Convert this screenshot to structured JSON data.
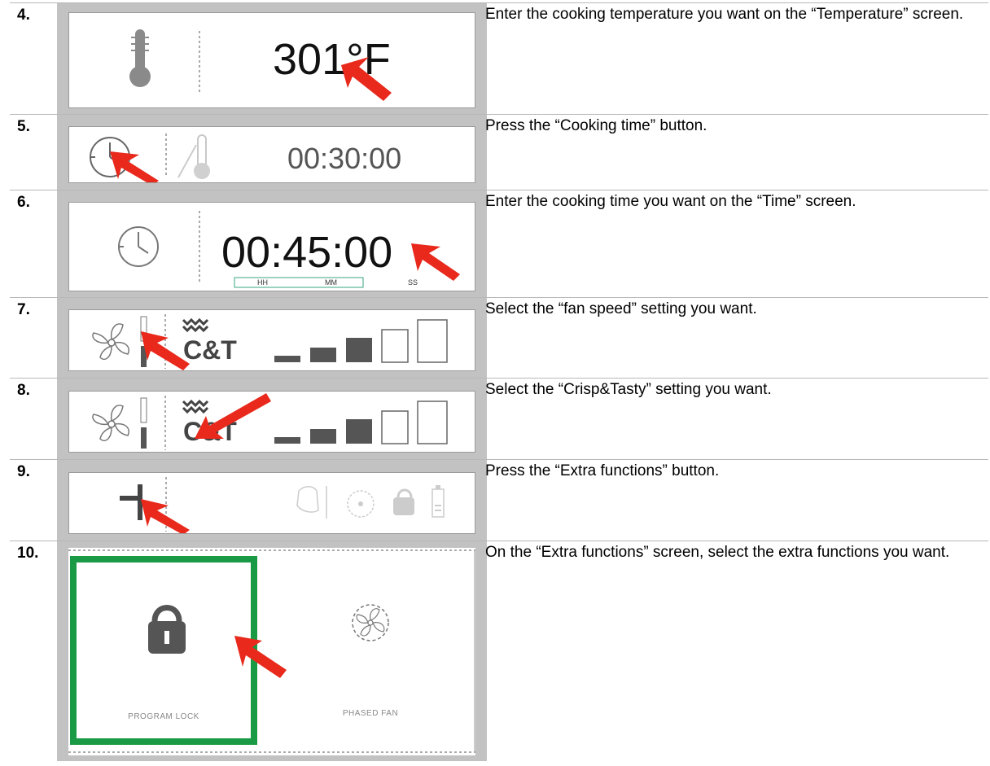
{
  "steps": [
    {
      "number": "4.",
      "text": "Enter the cooking temperature you want on the “Temperature” screen.",
      "display": "301°F",
      "icon": "thermometer-icon"
    },
    {
      "number": "5.",
      "text": "Press the “Cooking time” button.",
      "display": "00:30:00",
      "icon": "clock-icon"
    },
    {
      "number": "6.",
      "text": "Enter the cooking time you want on the “Time” screen.",
      "display": "00:45:00",
      "field_labels": [
        "HH",
        "MM",
        "SS"
      ],
      "icon": "clock-icon"
    },
    {
      "number": "7.",
      "text": "Select the “fan speed” setting you want.",
      "logo": "C&T",
      "icon": "fan-icon"
    },
    {
      "number": "8.",
      "text": "Select the “Crisp&Tasty” setting you want.",
      "logo": "C&T",
      "icon": "fan-icon"
    },
    {
      "number": "9.",
      "text": "Press the “Extra functions” button.",
      "icon": "extra-functions-icon"
    },
    {
      "number": "10.",
      "text": "On the “Extra functions” screen, select the extra functions you want.",
      "tiles": [
        "PROGRAM LOCK",
        "PHASED FAN"
      ]
    }
  ],
  "colors": {
    "arrow": "#e8291c",
    "selection": "#1a9a44",
    "icon_gray": "#7a7a7a",
    "bar_dark": "#555555"
  }
}
